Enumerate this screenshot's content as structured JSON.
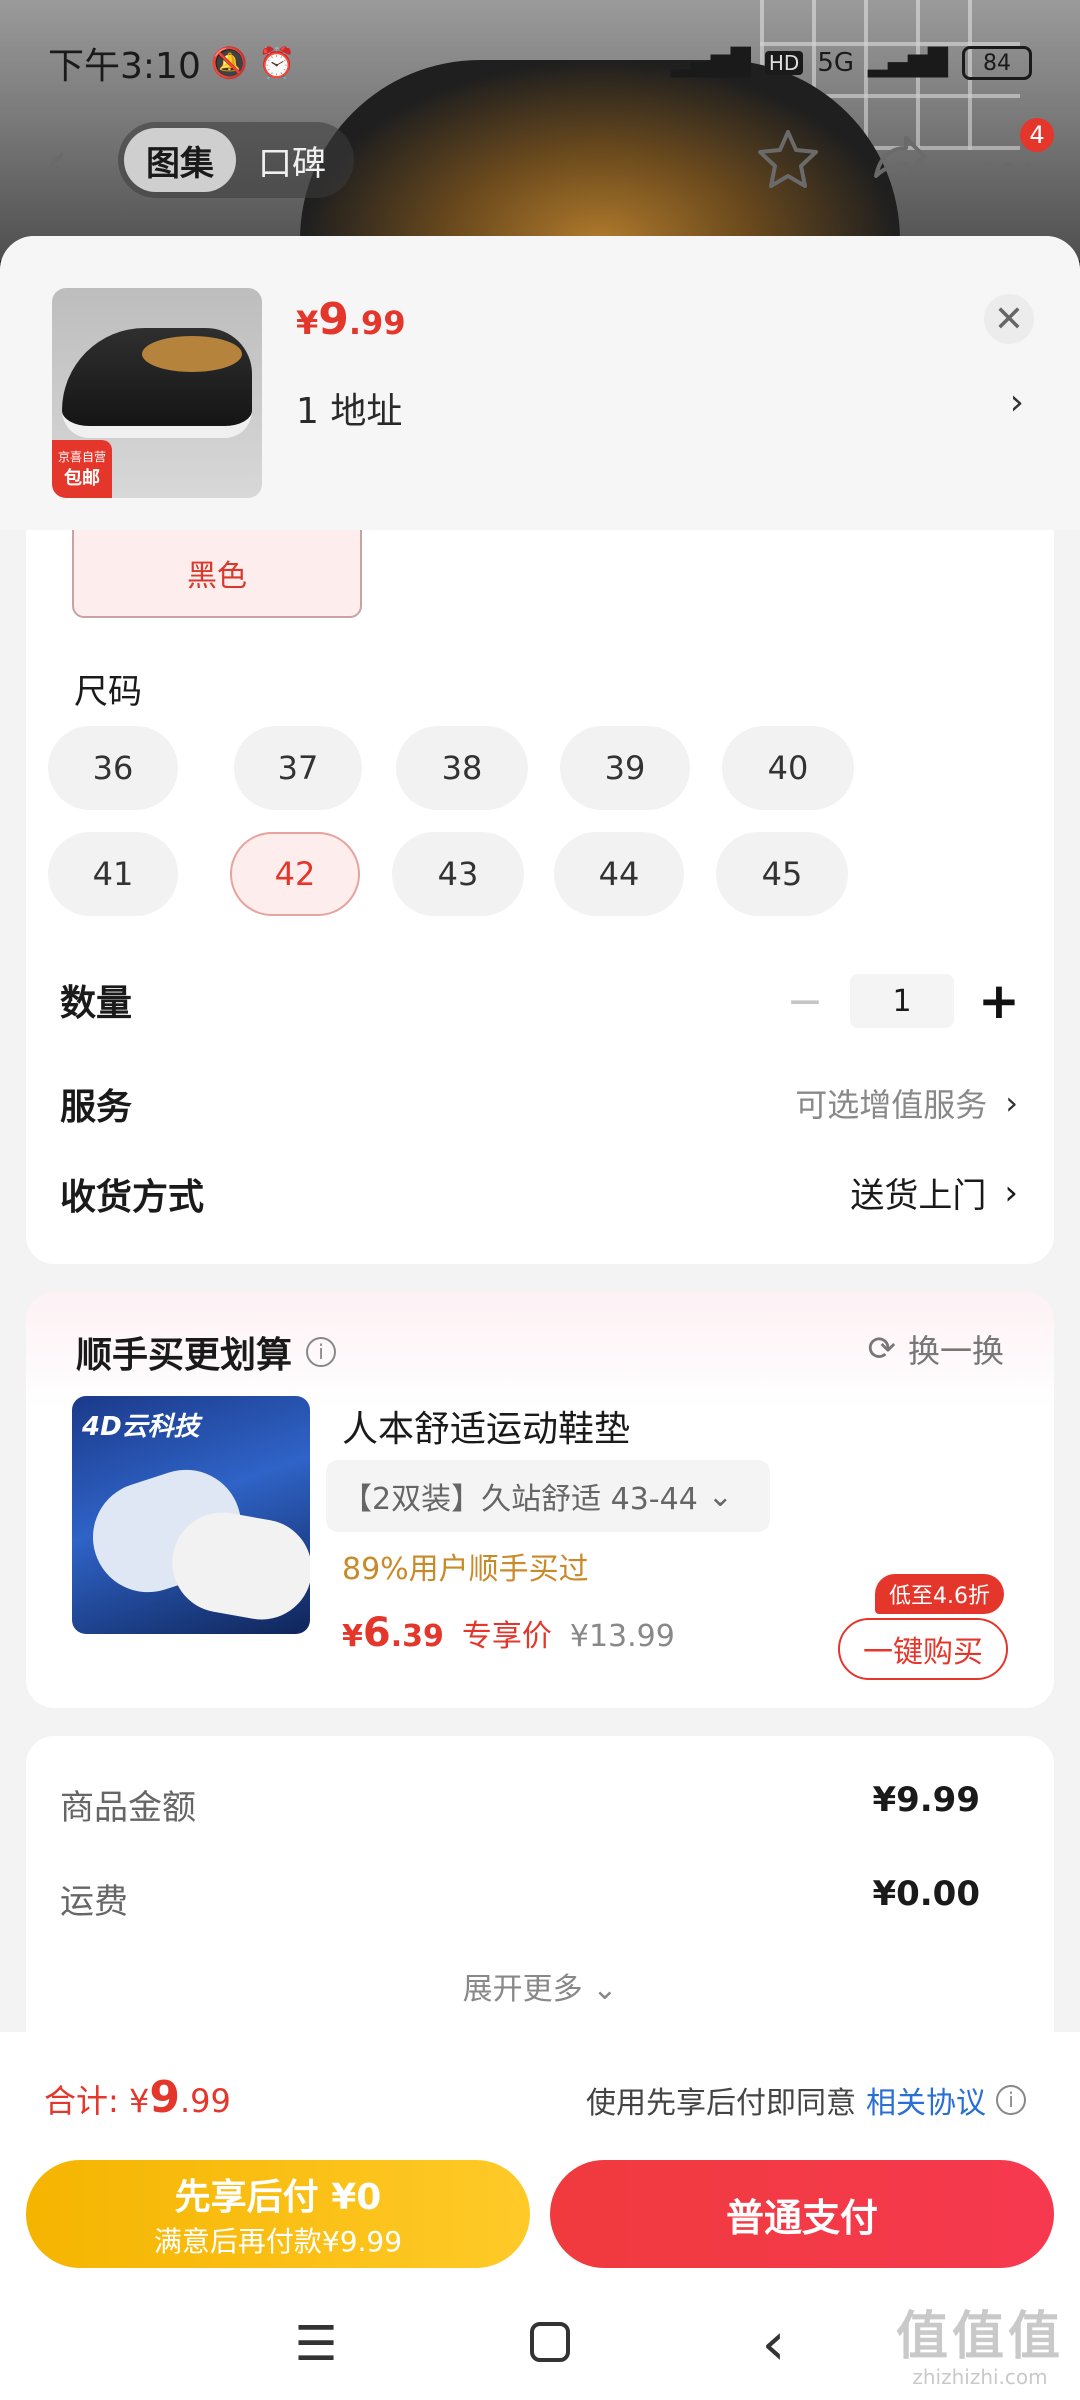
{
  "status_bar": {
    "time": "下午3:10",
    "network": "5G",
    "hd": "HD",
    "battery": "84"
  },
  "top_nav": {
    "tabs": [
      {
        "label": "图集",
        "active": true
      },
      {
        "label": "口碑",
        "active": false
      }
    ],
    "cart_badge": "4"
  },
  "product": {
    "price_symbol": "¥",
    "price_int": "9",
    "price_dec": ".99",
    "address": "1  地址",
    "thumb_tag_top": "京喜自营",
    "thumb_tag_bottom": "包邮"
  },
  "options": {
    "color_selected": "黑色",
    "size_label": "尺码",
    "sizes": [
      "36",
      "37",
      "38",
      "39",
      "40",
      "41",
      "42",
      "43",
      "44",
      "45"
    ],
    "selected_size": "42",
    "quantity_label": "数量",
    "quantity": "1",
    "service_label": "服务",
    "service_value": "可选增值服务",
    "delivery_label": "收货方式",
    "delivery_value": "送货上门"
  },
  "addon": {
    "title": "顺手买更划算",
    "refresh_label": "换一换",
    "image_text": "4D云科技",
    "name": "人本舒适运动鞋垫",
    "spec": "【2双装】久站舒适   43-44",
    "sold": "89%用户顺手买过",
    "price_symbol": "¥",
    "price_int": "6",
    "price_dec": ".39",
    "price_tag": "专享价",
    "orig_price": "¥13.99",
    "discount_badge": "低至4.6折",
    "buy_button": "一键购买"
  },
  "summary": {
    "goods_label": "商品金额",
    "goods_value": "¥9.99",
    "shipping_label": "运费",
    "shipping_value": "¥0.00",
    "expand_label": "展开更多"
  },
  "bottom": {
    "total_label": "合计: ",
    "total_symbol": "¥",
    "total_int": "9",
    "total_dec": ".99",
    "agree_text": "使用先享后付即同意",
    "agree_link": "相关协议",
    "bnpl_title": "先享后付 ¥0",
    "bnpl_sub": "满意后再付款¥9.99",
    "normal_pay": "普通支付"
  },
  "watermark": {
    "big": "值值值",
    "small": "zhizhizhi.com"
  },
  "colors": {
    "accent_red": "#e5362b",
    "bnpl_yellow": "#f5b400",
    "link_blue": "#2a6fd6"
  }
}
